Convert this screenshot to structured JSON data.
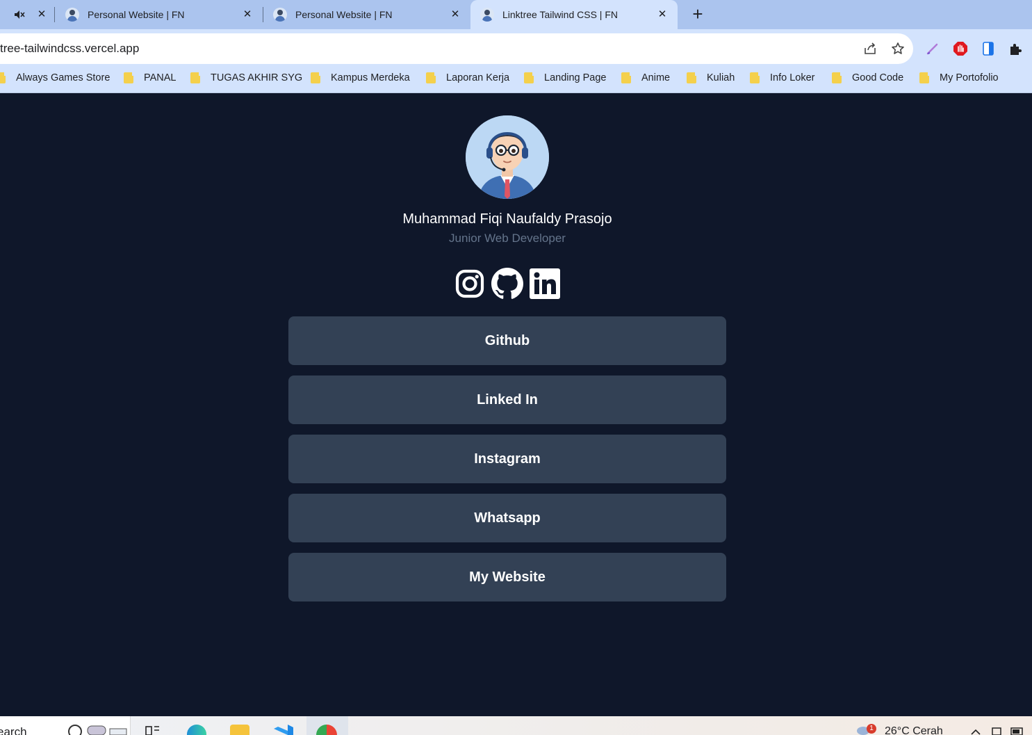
{
  "browser": {
    "tabs": [
      {
        "title": "Personal Website | FN"
      },
      {
        "title": "Personal Website | FN"
      },
      {
        "title": "Linktree Tailwind CSS | FN",
        "active": true
      }
    ],
    "url": "tree-tailwindcss.vercel.app",
    "bookmarks": [
      "Always Games Store",
      "PANAL",
      "TUGAS AKHIR SYG",
      "Kampus Merdeka",
      "Laporan Kerja",
      "Landing Page",
      "Anime",
      "Kuliah",
      "Info Loker",
      "Good Code",
      "My Portofolio"
    ]
  },
  "profile": {
    "name": "Muhammad Fiqi Naufaldy Prasojo",
    "role": "Junior Web Developer"
  },
  "social_icons": [
    "instagram-icon",
    "github-icon",
    "linkedin-icon"
  ],
  "links": [
    "Github",
    "Linked In",
    "Instagram",
    "Whatsapp",
    "My Website"
  ],
  "taskbar": {
    "search_text": "earch",
    "weather": "26°C  Cerah",
    "notification_count": "1"
  },
  "colors": {
    "page_bg": "#0f172a",
    "button_bg": "#334155",
    "subtitle": "#64748b",
    "chrome_tabbar": "#abc4ee",
    "chrome_toolbar": "#d3e3fd"
  }
}
